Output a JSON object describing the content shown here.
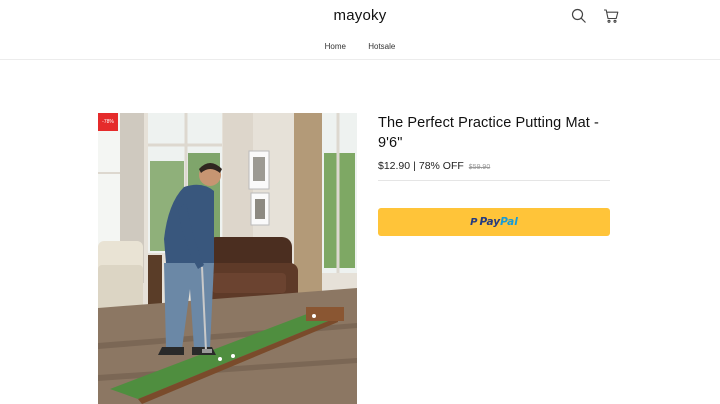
{
  "header": {
    "brand": "mayoky",
    "nav": [
      {
        "label": "Home"
      },
      {
        "label": "Hotsale"
      }
    ],
    "icons": [
      "search-icon",
      "cart-icon"
    ]
  },
  "product": {
    "badge": "-78%",
    "title": "The Perfect Practice Putting Mat - 9'6\"",
    "price": "$12.90",
    "separator": "|",
    "discount": "78% OFF",
    "compare_price": "$59.90",
    "paypal": {
      "mark": "P",
      "pay": "Pay",
      "pal": "Pal"
    }
  },
  "colors": {
    "badge": "#e52b2b",
    "paypal_button": "#ffc439",
    "paypal_dark": "#253b80",
    "paypal_light": "#179bd7"
  }
}
